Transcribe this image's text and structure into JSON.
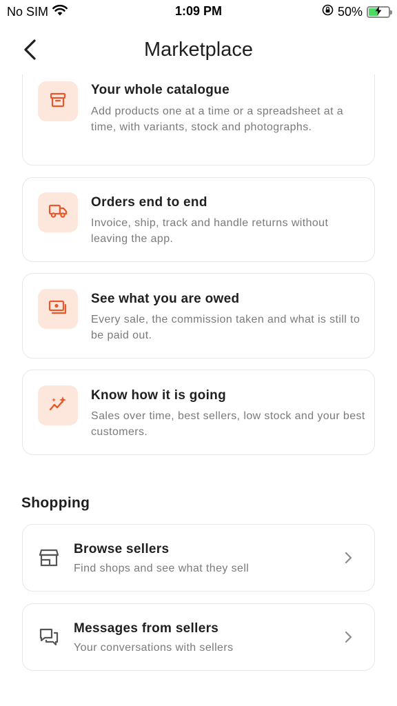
{
  "status_bar": {
    "carrier": "No SIM",
    "time": "1:09 PM",
    "battery_percent": "50%",
    "battery_level": 0.5
  },
  "nav": {
    "title": "Marketplace",
    "back_icon": "chevron-left-icon"
  },
  "features": [
    {
      "icon": "archive-box-icon",
      "title": "Your whole catalogue",
      "description": "Add products one at a time or a spreadsheet at a time, with variants, stock and photographs."
    },
    {
      "icon": "delivery-truck-icon",
      "title": "Orders end to end",
      "description": "Invoice, ship, track and handle returns without leaving the app."
    },
    {
      "icon": "payout-cash-icon",
      "title": "See what you are owed",
      "description": "Every sale, the commission taken and what is still to be paid out."
    },
    {
      "icon": "sparkle-trend-icon",
      "title": "Know how it is going",
      "description": "Sales over time, best sellers, low stock and your best customers."
    }
  ],
  "shopping": {
    "title": "Shopping",
    "items": [
      {
        "icon": "storefront-icon",
        "title": "Browse sellers",
        "subtitle": "Find shops and see what they sell"
      },
      {
        "icon": "chat-bubbles-icon",
        "title": "Messages from sellers",
        "subtitle": "Your conversations with sellers"
      }
    ]
  },
  "colors": {
    "accent": "#e8582a",
    "icon_tile": "#fde7dc",
    "text_primary": "#1f1f1f",
    "text_secondary": "#7a7a7a",
    "card_border": "#e7e7e7",
    "battery_fill": "#4cd964"
  }
}
